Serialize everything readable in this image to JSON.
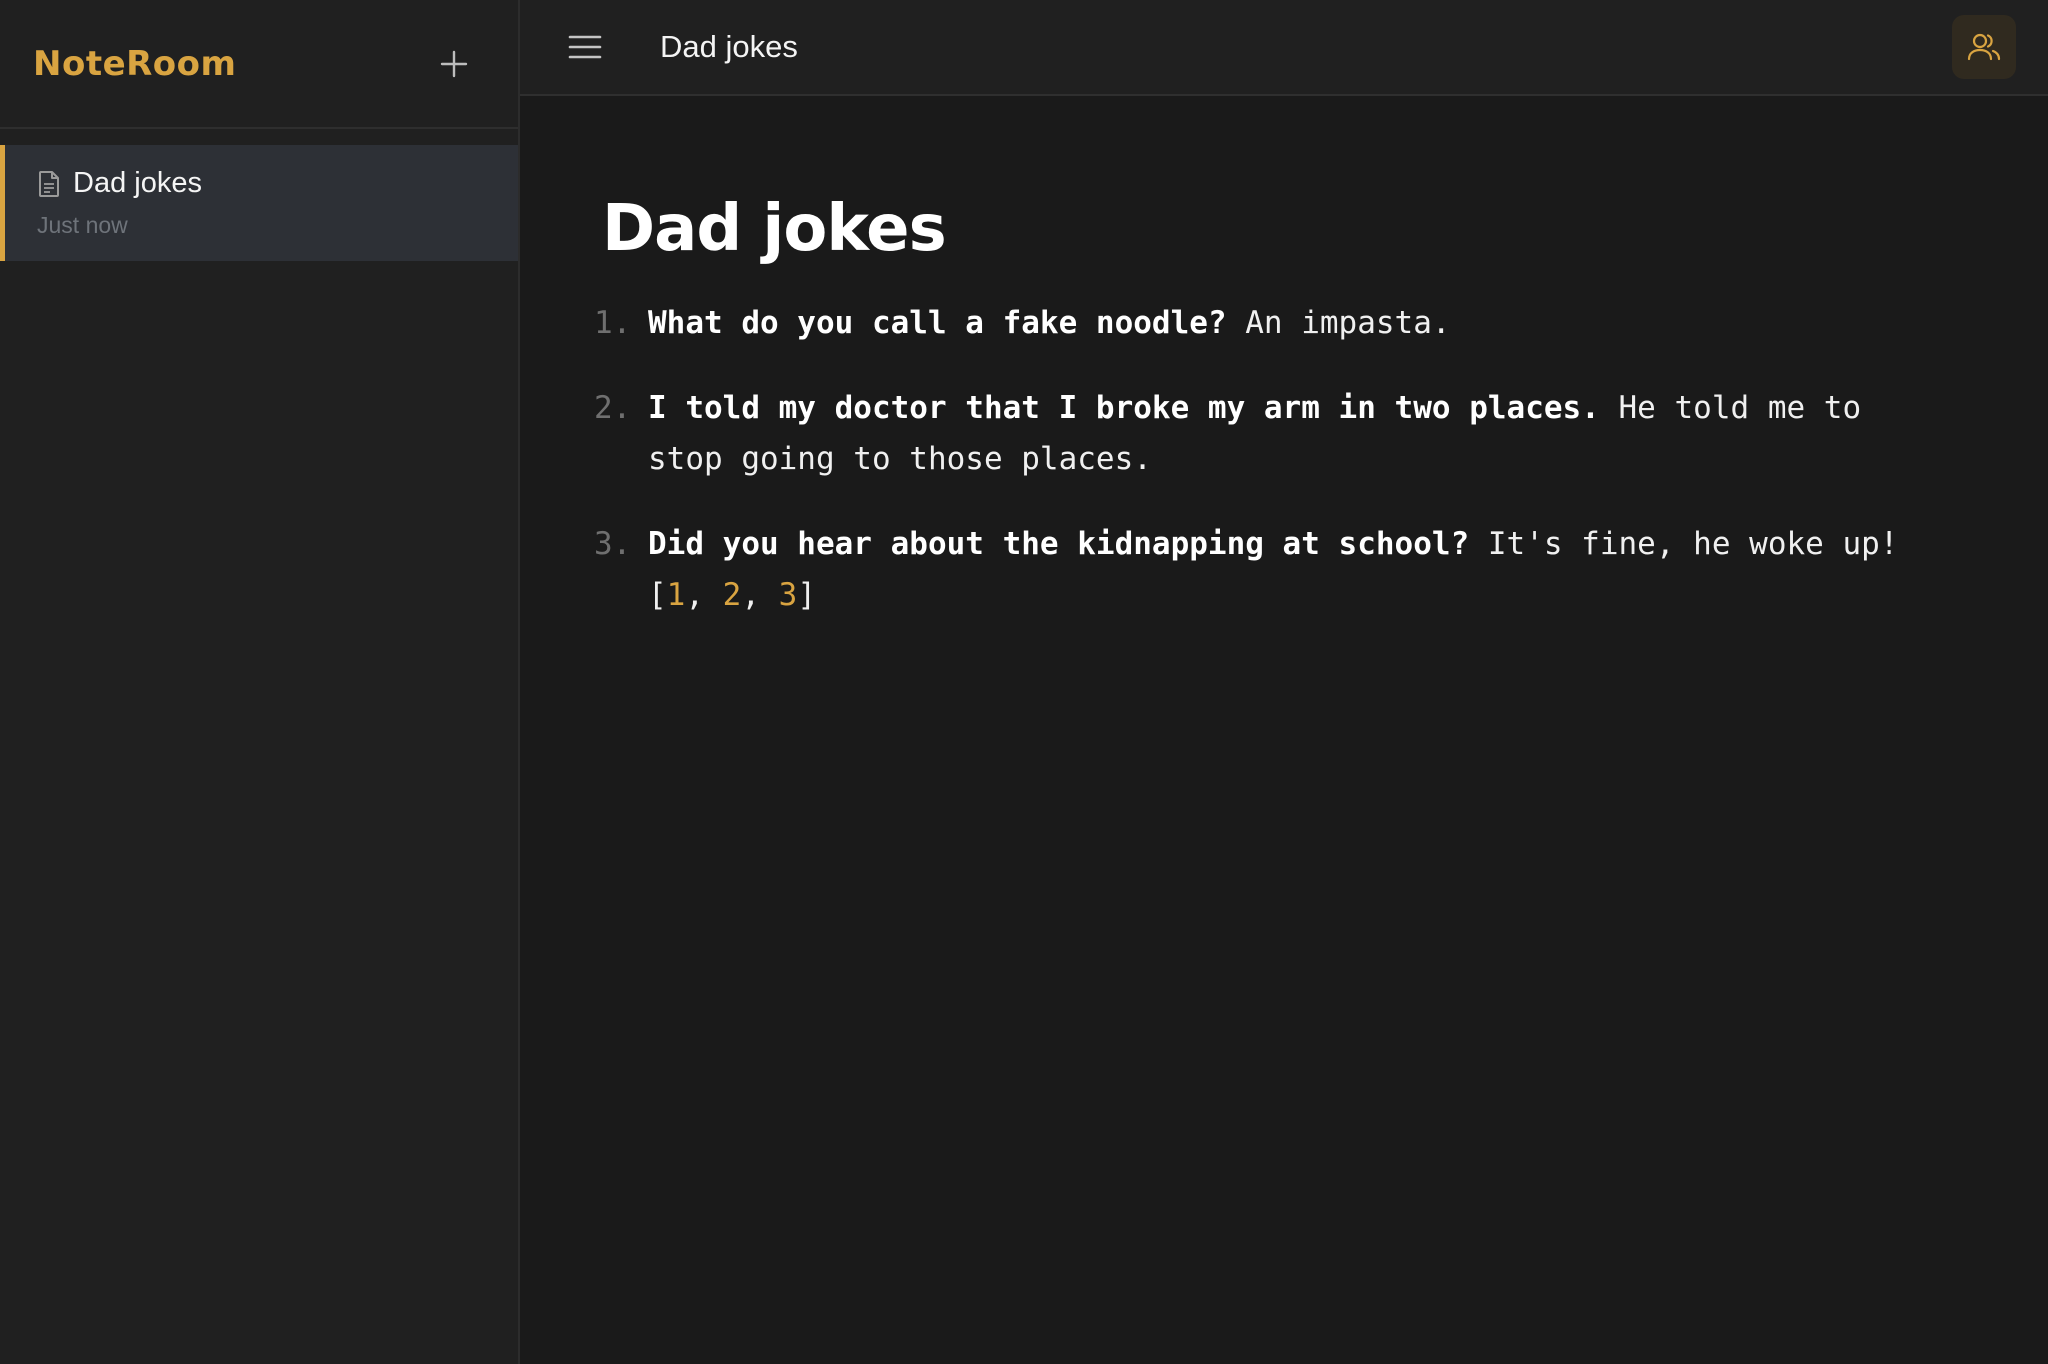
{
  "colors": {
    "accent": "#d9a441",
    "sidebar_bg": "#202020",
    "main_bg": "#1a1a1a",
    "selected_item_bg": "#2d3036"
  },
  "sidebar": {
    "brand": "NoteRoom",
    "new_note_icon": "plus-icon",
    "notes": [
      {
        "icon": "document-icon",
        "title": "Dad jokes",
        "time": "Just now",
        "selected": true
      }
    ]
  },
  "topbar": {
    "menu_icon": "hamburger-menu-icon",
    "title": "Dad jokes",
    "share_icon": "users-icon"
  },
  "document": {
    "title": "Dad jokes",
    "jokes": [
      {
        "number": "1.",
        "question": "What do you call a fake noodle?",
        "answer": " An impasta."
      },
      {
        "number": "2.",
        "question": "I told my doctor that I broke my arm in two places.",
        "answer": " He told me to stop going to those places."
      },
      {
        "number": "3.",
        "question": "Did you hear about the kidnapping at school?",
        "answer": " It's fine, he woke up!"
      }
    ],
    "references": {
      "open": " [",
      "items": [
        "1",
        "2",
        "3"
      ],
      "separator": ", ",
      "close": "]"
    }
  }
}
